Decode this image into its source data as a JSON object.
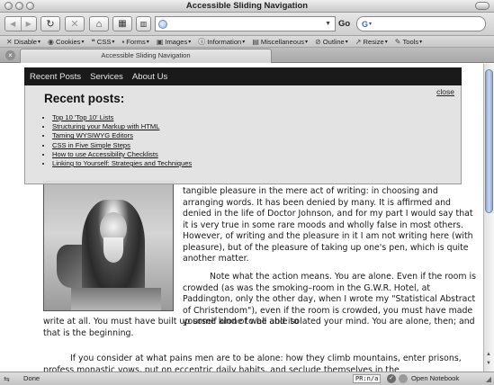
{
  "window": {
    "title": "Accessible Sliding Navigation"
  },
  "navbar": {
    "back_icon": "back-arrow-icon",
    "forward_icon": "forward-arrow-icon",
    "reload_icon": "reload-icon",
    "stop_icon": "stop-icon",
    "home_icon": "home-icon",
    "address_value": "",
    "go_label": "Go",
    "search_engine": "G",
    "search_value": ""
  },
  "devbar": {
    "items": [
      {
        "icon": "✕",
        "label": "Disable"
      },
      {
        "icon": "◉",
        "label": "Cookies"
      },
      {
        "icon": "❝",
        "label": "CSS"
      },
      {
        "icon": "▪",
        "label": "Forms"
      },
      {
        "icon": "▣",
        "label": "Images"
      },
      {
        "icon": "ⓘ",
        "label": "Information"
      },
      {
        "icon": "▤",
        "label": "Miscellaneous"
      },
      {
        "icon": "⊘",
        "label": "Outline"
      },
      {
        "icon": "↗",
        "label": "Resize"
      },
      {
        "icon": "✎",
        "label": "Tools"
      }
    ]
  },
  "tab": {
    "title": "Accessible Sliding Navigation",
    "close_symbol": "×"
  },
  "site_nav": {
    "items": [
      "Recent Posts",
      "Services",
      "About Us"
    ]
  },
  "panel": {
    "heading": "Recent posts:",
    "close_label": "close",
    "links": [
      "Top 10 'Top 10' Lists",
      "Structuring your Markup with HTML",
      "Taming WYSIWYG Editors",
      "CSS in Five Simple Steps",
      "How to use Accessibility Checklists",
      "Linking to Yourself: Strategies and Techniques"
    ]
  },
  "article": {
    "para1": "tangible pleasure in the mere act of writing: in choosing and arranging words. It has been denied by many. It is affirmed and denied in the life of Doctor Johnson, and for my part I would say that it is very true in some rare moods and wholly false in most others. However, of writing and the pleasure in it I am not writing here (with pleasure), but of the pleasure of taking up one's pen, which is quite another matter.",
    "para2_start": "Note what the action means. You are alone. Even if the room is crowded (as was the smoking–room in the G.W.R. Hotel, at Paddington, only the other day, when I wrote my \"Statistical Abstract of Christendom\"), even if the room is crowded, you must have made yourself alone to be able to",
    "para2_end": "write at all. You must have built up some kind of wall and isolated your mind. You are alone, then; and that is the beginning.",
    "para3": "If you consider at what pains men are to be alone: how they climb mountains, enter prisons, profess monastic vows, put on eccentric daily habits, and seclude themselves in the"
  },
  "statusbar": {
    "text": "Done",
    "pagerank": "PR:n/a",
    "notebook": "Open Notebook"
  }
}
